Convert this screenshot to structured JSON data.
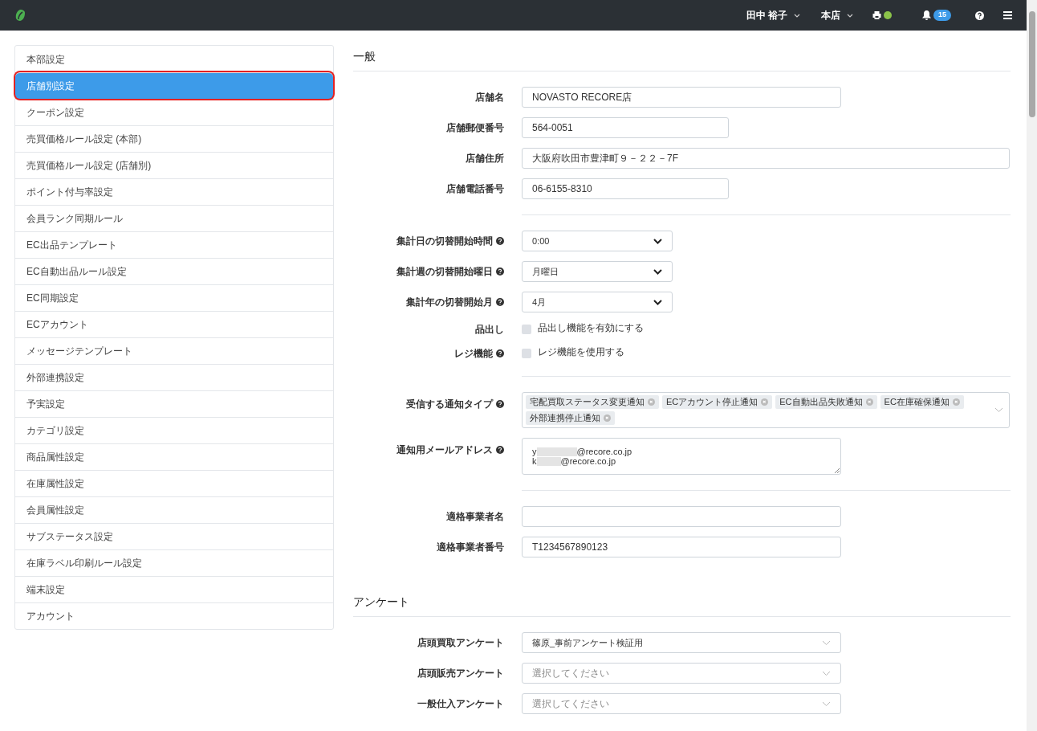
{
  "header": {
    "user": "田中 裕子",
    "store": "本店",
    "printer_online": true,
    "notifications": "15"
  },
  "sidebar": {
    "items": [
      {
        "label": "本部設定",
        "selected": false
      },
      {
        "label": "店舗別設定",
        "selected": true
      },
      {
        "label": "クーポン設定",
        "selected": false
      },
      {
        "label": "売買価格ルール設定 (本部)",
        "selected": false
      },
      {
        "label": "売買価格ルール設定 (店舗別)",
        "selected": false
      },
      {
        "label": "ポイント付与率設定",
        "selected": false
      },
      {
        "label": "会員ランク同期ルール",
        "selected": false
      },
      {
        "label": "EC出品テンプレート",
        "selected": false
      },
      {
        "label": "EC自動出品ルール設定",
        "selected": false
      },
      {
        "label": "EC同期設定",
        "selected": false
      },
      {
        "label": "ECアカウント",
        "selected": false
      },
      {
        "label": "メッセージテンプレート",
        "selected": false
      },
      {
        "label": "外部連携設定",
        "selected": false
      },
      {
        "label": "予実設定",
        "selected": false
      },
      {
        "label": "カテゴリ設定",
        "selected": false
      },
      {
        "label": "商品属性設定",
        "selected": false
      },
      {
        "label": "在庫属性設定",
        "selected": false
      },
      {
        "label": "会員属性設定",
        "selected": false
      },
      {
        "label": "サブステータス設定",
        "selected": false
      },
      {
        "label": "在庫ラベル印刷ルール設定",
        "selected": false
      },
      {
        "label": "端末設定",
        "selected": false
      },
      {
        "label": "アカウント",
        "selected": false
      }
    ]
  },
  "sections": [
    {
      "title": "一般",
      "groups": [
        [
          {
            "kind": "text",
            "label": "店舗名",
            "help": false,
            "value": "NOVASTO RECORE店"
          },
          {
            "kind": "short_text",
            "label": "店舗郵便番号",
            "help": false,
            "value": "564-0051"
          },
          {
            "kind": "wide_text",
            "label": "店舗住所",
            "help": false,
            "value": "大阪府吹田市豊津町９－２２－7F"
          },
          {
            "kind": "short_text",
            "label": "店舗電話番号",
            "help": false,
            "value": "06-6155-8310"
          }
        ],
        [
          {
            "kind": "select",
            "label": "集計日の切替開始時間",
            "help": true,
            "value": "0:00"
          },
          {
            "kind": "select",
            "label": "集計週の切替開始曜日",
            "help": true,
            "value": "月曜日"
          },
          {
            "kind": "select",
            "label": "集計年の切替開始月",
            "help": true,
            "value": "4月"
          },
          {
            "kind": "checkbox",
            "label": "品出し",
            "help": false,
            "text": "品出し機能を有効にする",
            "checked": false
          },
          {
            "kind": "checkbox",
            "label": "レジ機能",
            "help": true,
            "text": "レジ機能を使用する",
            "checked": false
          }
        ],
        [
          {
            "kind": "tags",
            "label": "受信する通知タイプ",
            "help": true,
            "tags": [
              "宅配買取ステータス変更通知",
              "ECアカウント停止通知",
              "EC自動出品失敗通知",
              "EC在庫確保通知",
              "外部連携停止通知"
            ]
          },
          {
            "kind": "textarea",
            "label": "通知用メールアドレス",
            "help": true,
            "lines": [
              {
                "start": "y",
                "end": "@recore.co.jp"
              },
              {
                "start": "k",
                "end": "@recore.co.jp"
              }
            ]
          }
        ],
        [
          {
            "kind": "text",
            "label": "適格事業者名",
            "help": false
          },
          {
            "kind": "text",
            "label": "適格事業者番号",
            "help": false,
            "value": "T1234567890123"
          }
        ]
      ]
    },
    {
      "title": "アンケート",
      "groups": [
        [
          {
            "kind": "dropdown",
            "label": "店頭買取アンケート",
            "help": false,
            "value": "篠原_事前アンケート検証用"
          },
          {
            "kind": "dropdown",
            "label": "店頭販売アンケート",
            "help": false,
            "placeholder": "選択してください"
          },
          {
            "kind": "dropdown",
            "label": "一般仕入アンケート",
            "help": false,
            "placeholder": "選択してください"
          }
        ]
      ]
    }
  ]
}
